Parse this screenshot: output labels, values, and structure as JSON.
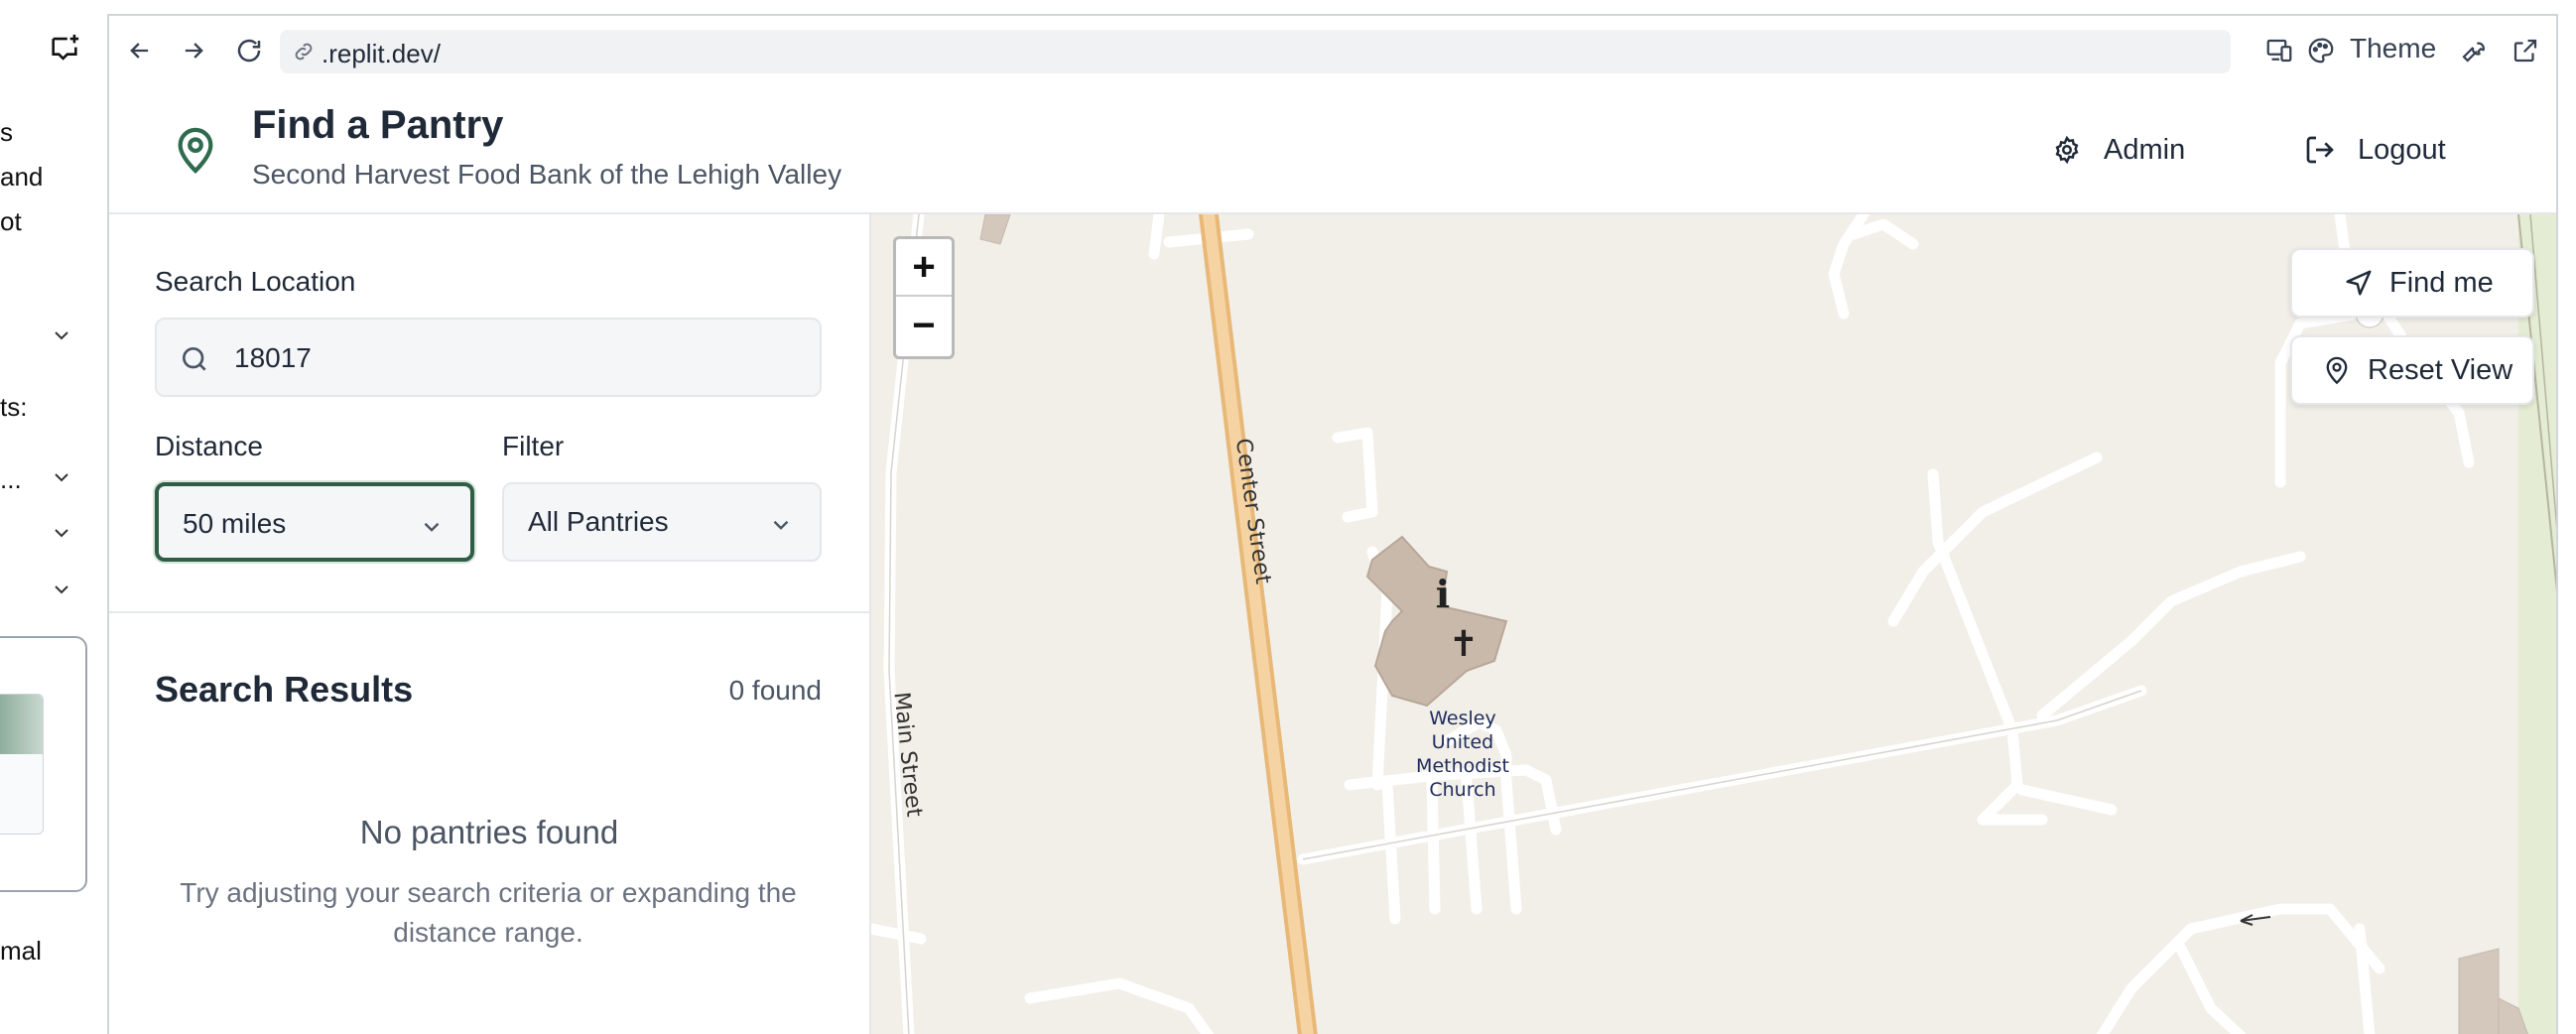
{
  "left_panel": {
    "fragments": [
      "s",
      "and",
      "ot",
      "ts:",
      "...",
      "mal"
    ]
  },
  "browser": {
    "url": ".replit.dev/",
    "theme_label": "Theme"
  },
  "header": {
    "title": "Find a Pantry",
    "subtitle": "Second Harvest Food Bank of the Lehigh Valley",
    "admin_label": "Admin",
    "logout_label": "Logout"
  },
  "search": {
    "label": "Search Location",
    "value": "18017",
    "distance_label": "Distance",
    "distance_value": "50 miles",
    "filter_label": "Filter",
    "filter_value": "All Pantries"
  },
  "results": {
    "title": "Search Results",
    "count": "0 found",
    "empty_title": "No pantries found",
    "empty_text": "Try adjusting your search criteria or expanding the distance range."
  },
  "map": {
    "find_me_label": "Find me",
    "reset_view_label": "Reset View",
    "zoom_in": "+",
    "zoom_out": "−",
    "street_center": "Center Street",
    "street_main": "Main Street",
    "poi_church": [
      "Wesley",
      "United",
      "Methodist",
      "Church"
    ]
  }
}
